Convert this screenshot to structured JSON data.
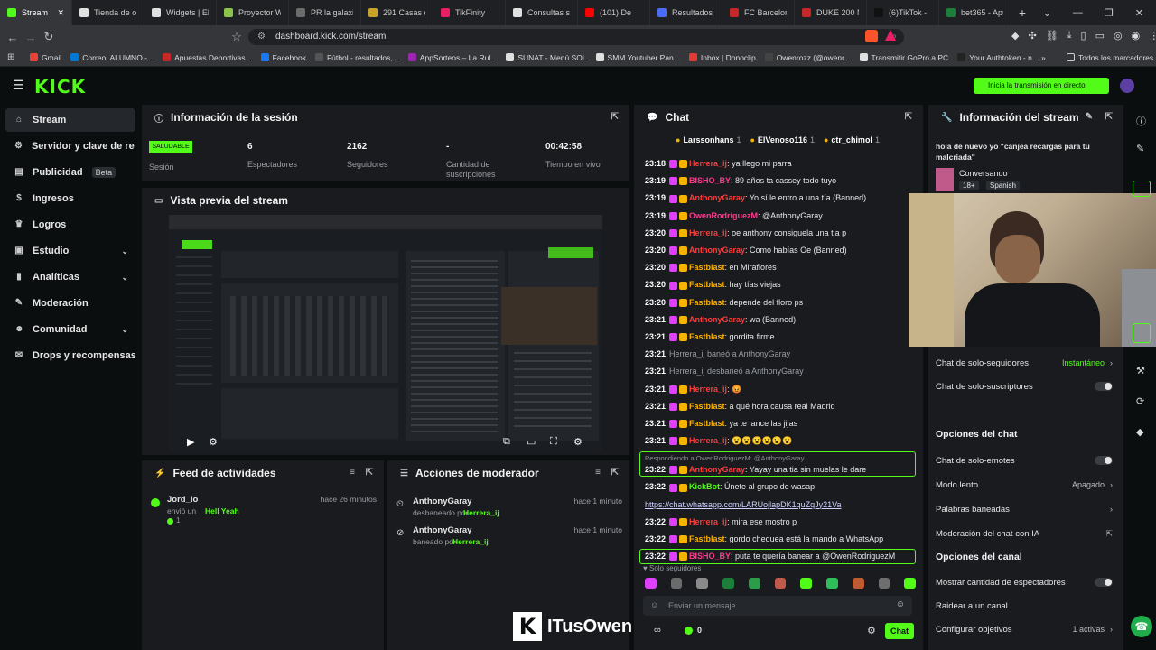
{
  "browser": {
    "tabs": [
      {
        "label": "Stream",
        "color": "#53fc18",
        "active": true
      },
      {
        "label": "Tienda de ov",
        "color": "#e0e0e0"
      },
      {
        "label": "Widgets | El",
        "color": "#e0e0e0"
      },
      {
        "label": "Proyector W",
        "color": "#8bc34a"
      },
      {
        "label": "PR la galaxia",
        "color": "#6b6b6b"
      },
      {
        "label": "291 Casas en",
        "color": "#c9a227"
      },
      {
        "label": "TikFinity",
        "color": "#e91e63"
      },
      {
        "label": "Consultas so",
        "color": "#e0e0e0"
      },
      {
        "label": "(101) De",
        "color": "#ff0000"
      },
      {
        "label": "Resultados d",
        "color": "#4a6cf7"
      },
      {
        "label": "FC Barcelona",
        "color": "#c62828"
      },
      {
        "label": "DUKE 200 N",
        "color": "#c62828"
      },
      {
        "label": "(6)TikTok -",
        "color": "#111111"
      },
      {
        "label": "bet365 - Apu",
        "color": "#1b7f3a"
      }
    ],
    "url": "dashboard.kick.com/stream",
    "bookmarks": [
      {
        "label": "Gmail",
        "color": "#ea4335"
      },
      {
        "label": "Correo: ALUMNO -...",
        "color": "#0078d4"
      },
      {
        "label": "Apuestas Deportivas...",
        "color": "#c62828"
      },
      {
        "label": "Facebook",
        "color": "#1877f2"
      },
      {
        "label": "Fútbol - resultados,...",
        "color": "#555555"
      },
      {
        "label": "AppSorteos – La Rul...",
        "color": "#9c27b0"
      },
      {
        "label": "SUNAT - Menú SOL",
        "color": "#e0e0e0"
      },
      {
        "label": "SMM Youtuber Pan...",
        "color": "#e0e0e0"
      },
      {
        "label": "Inbox | Donoclip",
        "color": "#e53935"
      },
      {
        "label": "Owenrozz (@owenr...",
        "color": "#444444"
      },
      {
        "label": "Transmitir GoPro a PC",
        "color": "#e0e0e0"
      },
      {
        "label": "Your Authtoken - n...",
        "color": "#222222"
      }
    ],
    "bookmarks_more": "»",
    "all_bookmarks": "Todos los marcadores"
  },
  "kick": {
    "logo": "KICK",
    "go_live_banner": "Inicia la transmisión en directo",
    "sidebar": [
      {
        "label": "Stream",
        "icon": "home-icon",
        "active": true
      },
      {
        "label": "Servidor y clave de retransmisión",
        "icon": "gear-icon"
      },
      {
        "label": "Publicidad",
        "icon": "ad-icon",
        "badge": "Beta"
      },
      {
        "label": "Ingresos",
        "icon": "dollar-icon"
      },
      {
        "label": "Logros",
        "icon": "trophy-icon"
      },
      {
        "label": "Estudio",
        "icon": "studio-icon",
        "chevron": true
      },
      {
        "label": "Analíticas",
        "icon": "chart-icon",
        "chevron": true
      },
      {
        "label": "Moderación",
        "icon": "sword-icon"
      },
      {
        "label": "Comunidad",
        "icon": "people-icon",
        "chevron": true
      },
      {
        "label": "Drops y recompensas",
        "icon": "gift-icon"
      }
    ],
    "session": {
      "title": "Información de la sesión",
      "health_badge": "SALUDABLE",
      "health_label": "Sesión",
      "stats": [
        {
          "value": "6",
          "label": "Espectadores"
        },
        {
          "value": "2162",
          "label": "Seguidores"
        },
        {
          "value": "-",
          "label": "Cantidad de suscripciones"
        },
        {
          "value": "00:42:58",
          "label": "Tiempo en vivo"
        }
      ]
    },
    "preview": {
      "title": "Vista previa del stream"
    },
    "feed": {
      "title": "Feed de actividades",
      "items": [
        {
          "user": "Jord_lo",
          "action": "envió un",
          "gift": "Hell Yeah",
          "count": "1",
          "time": "hace 26 minutos"
        }
      ]
    },
    "mod_actions": {
      "title": "Acciones de moderador",
      "items": [
        {
          "user": "AnthonyGaray",
          "action": "desbaneado por",
          "by": "Herrera_ij",
          "time": "hace 1 minuto"
        },
        {
          "user": "AnthonyGaray",
          "action": "baneado por",
          "by": "Herrera_ij",
          "time": "hace 1 minuto"
        }
      ]
    },
    "chat": {
      "title": "Chat",
      "top_gifters": [
        {
          "name": "Larssonhans",
          "count": "1"
        },
        {
          "name": "ElVenoso116",
          "count": "1"
        },
        {
          "name": "ctr_chimol",
          "count": "1"
        }
      ],
      "messages": [
        {
          "time": "23:18",
          "user": "Herrera_ij",
          "color": "#ff3b3b",
          "text": ": ya llego mi parra"
        },
        {
          "time": "23:19",
          "user": "BISHO_BY",
          "color": "#ff3b8e",
          "text": ": 89 años ta cassey todo tuyo"
        },
        {
          "time": "23:19",
          "user": "AnthonyGaray",
          "color": "#ff3b3b",
          "text": ": Yo sí le entro a una tía (Banned)"
        },
        {
          "time": "23:19",
          "user": "OwenRodriguezM",
          "color": "#ff3b8e",
          "text": ": @AnthonyGaray"
        },
        {
          "time": "23:20",
          "user": "Herrera_ij",
          "color": "#ff3b3b",
          "text": ": oe anthony consiguela una tia p"
        },
        {
          "time": "23:20",
          "user": "AnthonyGaray",
          "color": "#ff3b3b",
          "text": ": Como habías Oe (Banned)"
        },
        {
          "time": "23:20",
          "user": "Fastblast",
          "color": "#ffb300",
          "text": ": en Miraflores"
        },
        {
          "time": "23:20",
          "user": "Fastblast",
          "color": "#ffb300",
          "text": ": hay tías viejas"
        },
        {
          "time": "23:20",
          "user": "Fastblast",
          "color": "#ffb300",
          "text": ": depende del floro ps"
        },
        {
          "time": "23:21",
          "user": "AnthonyGaray",
          "color": "#ff3b3b",
          "text": ": wa (Banned)"
        },
        {
          "time": "23:21",
          "user": "Fastblast",
          "color": "#ffb300",
          "text": ": gordita firme"
        },
        {
          "time": "23:21",
          "user": "",
          "color": "#9a9ea5",
          "text": "Herrera_ij baneó a AnthonyGaray"
        },
        {
          "time": "23:21",
          "user": "",
          "color": "#9a9ea5",
          "text": "Herrera_ij desbaneó a AnthonyGaray"
        },
        {
          "time": "23:21",
          "user": "Herrera_ij",
          "color": "#ff3b3b",
          "text": ": 😡"
        },
        {
          "time": "23:21",
          "user": "Fastblast",
          "color": "#ffb300",
          "text": ": a qué hora causa real Madrid"
        },
        {
          "time": "23:21",
          "user": "Fastblast",
          "color": "#ffb300",
          "text": ": ya te lance las jijas"
        },
        {
          "time": "23:21",
          "user": "Herrera_ij",
          "color": "#ff3b3b",
          "text": ": 😮😮😮😮😮😮"
        },
        {
          "time": "23:22",
          "user": "AnthonyGaray",
          "color": "#ff3b3b",
          "text": ": Yayay una tia sin muelas le dare",
          "reply": "Respondiendo a OwenRodriguezM: @AnthonyGaray"
        },
        {
          "time": "23:22",
          "user": "KickBot",
          "color": "#53fc18",
          "text": ": Únete al grupo de wasap:"
        },
        {
          "time": "",
          "user": "",
          "color": "#cfd3ff",
          "text": "https://chat.whatsapp.com/LARUojlapDK1quZqJy21Va"
        },
        {
          "time": "23:22",
          "user": "Herrera_ij",
          "color": "#ff3b3b",
          "text": ": mira ese mostro p"
        },
        {
          "time": "23:22",
          "user": "Fastblast",
          "color": "#ffb300",
          "text": ": gordo chequea está la mando a WhatsApp"
        },
        {
          "time": "23:22",
          "user": "BISHO_BY",
          "color": "#ff3b8e",
          "text": ": puta te quería banear a @OwenRodriguezM"
        }
      ],
      "followers_only_label": "Solo seguidores",
      "input_placeholder": "Enviar un mensaje",
      "points": "0",
      "send_button": "Chat"
    },
    "stream_info": {
      "title": "Información del stream",
      "stream_title": "hola de nuevo yo \"canjea recargas para tu malcriada\"",
      "category": "Conversando",
      "tags": [
        "18+",
        "Spanish"
      ],
      "settings": [
        {
          "label": "Chat de solo-seguidores",
          "value": "Instantáneo",
          "type": "link"
        },
        {
          "label": "Chat de solo-suscriptores",
          "type": "toggle"
        }
      ],
      "chat_options_title": "Opciones del chat",
      "chat_options": [
        {
          "label": "Chat de solo-emotes",
          "type": "toggle"
        },
        {
          "label": "Modo lento",
          "value": "Apagado",
          "type": "link"
        },
        {
          "label": "Palabras baneadas",
          "type": "link"
        },
        {
          "label": "Moderación del chat con IA",
          "type": "external"
        }
      ],
      "channel_options_title": "Opciones del canal",
      "channel_options": [
        {
          "label": "Mostrar cantidad de espectadores",
          "type": "toggle"
        },
        {
          "label": "Raidear a un canal",
          "type": "none"
        },
        {
          "label": "Configurar objetivos",
          "value": "1 activas",
          "type": "link"
        }
      ]
    },
    "watermark": "ITusOwen"
  }
}
